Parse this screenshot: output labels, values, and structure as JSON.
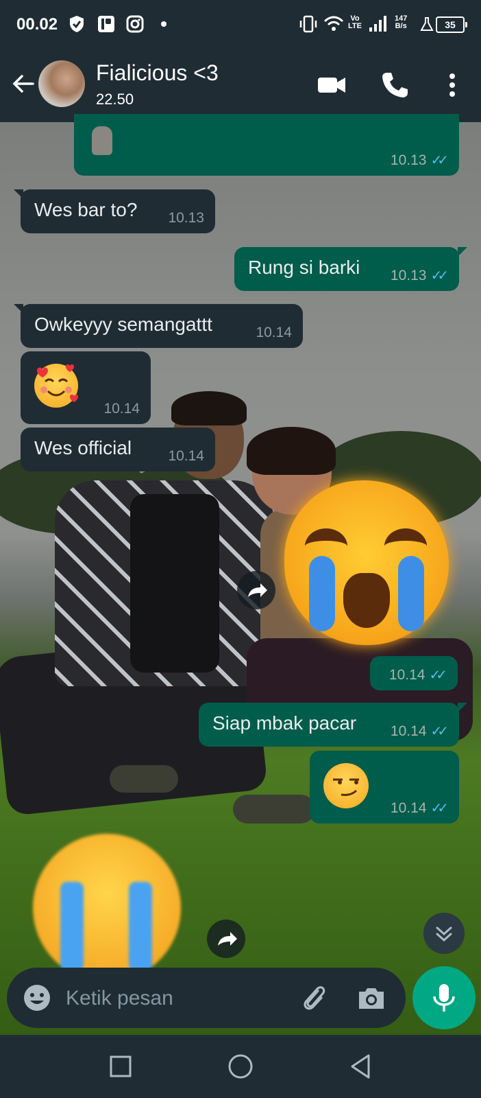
{
  "status_bar": {
    "time": "00.02",
    "network_type_top": "Vo",
    "network_type_bottom": "LTE",
    "speed_value": "147",
    "speed_unit": "B/s",
    "battery": "35"
  },
  "header": {
    "contact_name": "Fialicious <3",
    "last_seen": "22.50"
  },
  "messages": [
    {
      "direction": "out",
      "text": "",
      "emoji": "moai",
      "time": "10.13",
      "status": "read"
    },
    {
      "direction": "in",
      "text": "Wes bar to?",
      "time": "10.13"
    },
    {
      "direction": "out",
      "text": "Rung si barki",
      "time": "10.13",
      "status": "read"
    },
    {
      "direction": "in",
      "text": "Owkeyyy semangattt",
      "time": "10.14"
    },
    {
      "direction": "in",
      "text": "",
      "emoji": "smiling-face-with-hearts",
      "time": "10.14"
    },
    {
      "direction": "in",
      "text": "Wes official",
      "time": "10.14"
    },
    {
      "direction": "out",
      "text": "",
      "emoji": "loudly-crying-face-sticker",
      "time": "10.14",
      "status": "read"
    },
    {
      "direction": "out",
      "text": "Siap mbak pacar",
      "time": "10.14",
      "status": "read"
    },
    {
      "direction": "out",
      "text": "",
      "emoji": "smirking-face",
      "time": "10.14",
      "status": "read"
    },
    {
      "direction": "in",
      "text": "",
      "emoji": "loudly-crying-face-sticker",
      "time": ""
    }
  ],
  "composer": {
    "placeholder": "Ketik pesan"
  },
  "colors": {
    "bar_background": "#1f2c34",
    "incoming_bubble": "#1f2c34",
    "outgoing_bubble": "#005c4b",
    "accent_green": "#00a884",
    "read_tick_blue": "#53bdeb"
  },
  "icons": {
    "status": [
      "shield-icon",
      "app-p-icon",
      "instagram-icon",
      "dot-icon",
      "vibrate-icon",
      "wifi-icon",
      "signal-icon",
      "flask-icon",
      "battery-icon"
    ],
    "header": [
      "back-arrow-icon",
      "video-call-icon",
      "phone-icon",
      "more-vert-icon"
    ],
    "composer": [
      "emoji-icon",
      "attach-icon",
      "camera-icon",
      "mic-icon"
    ],
    "nav": [
      "recents-square-icon",
      "home-circle-icon",
      "back-triangle-icon"
    ]
  }
}
